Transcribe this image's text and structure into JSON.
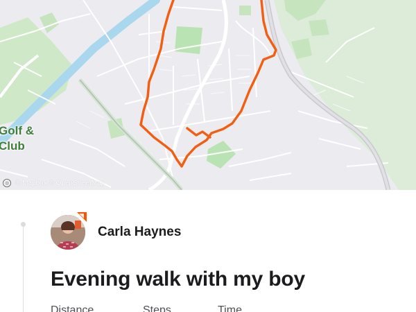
{
  "map": {
    "place_label": "Golf &\nClub",
    "attribution": "© Mapbox © OpenStreetMap",
    "route_color": "#f06014",
    "water_color": "#a9d7ee",
    "park_color": "#b9e3b2"
  },
  "activity": {
    "athlete_name": "Carla Haynes",
    "title": "Evening walk with my boy",
    "stats": [
      {
        "label": "Distance"
      },
      {
        "label": "Steps"
      },
      {
        "label": "Time"
      }
    ]
  },
  "icons": {
    "mapbox": "mapbox-logo-icon",
    "badge": "strava-badge-icon"
  }
}
